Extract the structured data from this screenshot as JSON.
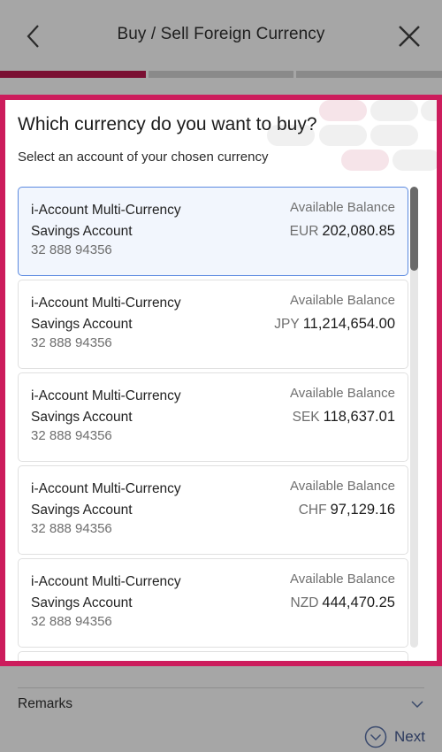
{
  "header": {
    "title": "Buy / Sell Foreign Currency",
    "back_icon": "chevron-left-icon",
    "close_icon": "close-icon"
  },
  "progress": {
    "total_steps": 3,
    "current_step": 1,
    "active_color": "#7a0f32",
    "inactive_color": "#8a8a8a"
  },
  "panel": {
    "highlight_color": "#cc1c5c",
    "question": "Which currency do you want to buy?",
    "subtitle": "Select an account of your chosen currency"
  },
  "accounts": [
    {
      "name": "i-Account Multi-Currency Savings Account",
      "number": "32 888 94356",
      "balance_label": "Available Balance",
      "currency": "EUR",
      "amount": "202,080.85",
      "selected": true
    },
    {
      "name": "i-Account Multi-Currency Savings Account",
      "number": "32 888 94356",
      "balance_label": "Available Balance",
      "currency": "JPY",
      "amount": "11,214,654.00",
      "selected": false
    },
    {
      "name": "i-Account Multi-Currency Savings Account",
      "number": "32 888 94356",
      "balance_label": "Available Balance",
      "currency": "SEK",
      "amount": "118,637.01",
      "selected": false
    },
    {
      "name": "i-Account Multi-Currency Savings Account",
      "number": "32 888 94356",
      "balance_label": "Available Balance",
      "currency": "CHF",
      "amount": "97,129.16",
      "selected": false
    },
    {
      "name": "i-Account Multi-Currency Savings Account",
      "number": "32 888 94356",
      "balance_label": "Available Balance",
      "currency": "NZD",
      "amount": "444,470.25",
      "selected": false
    }
  ],
  "footer": {
    "remarks_label": "Remarks",
    "next_label": "Next",
    "selected_border_color": "#5b8ae0"
  }
}
